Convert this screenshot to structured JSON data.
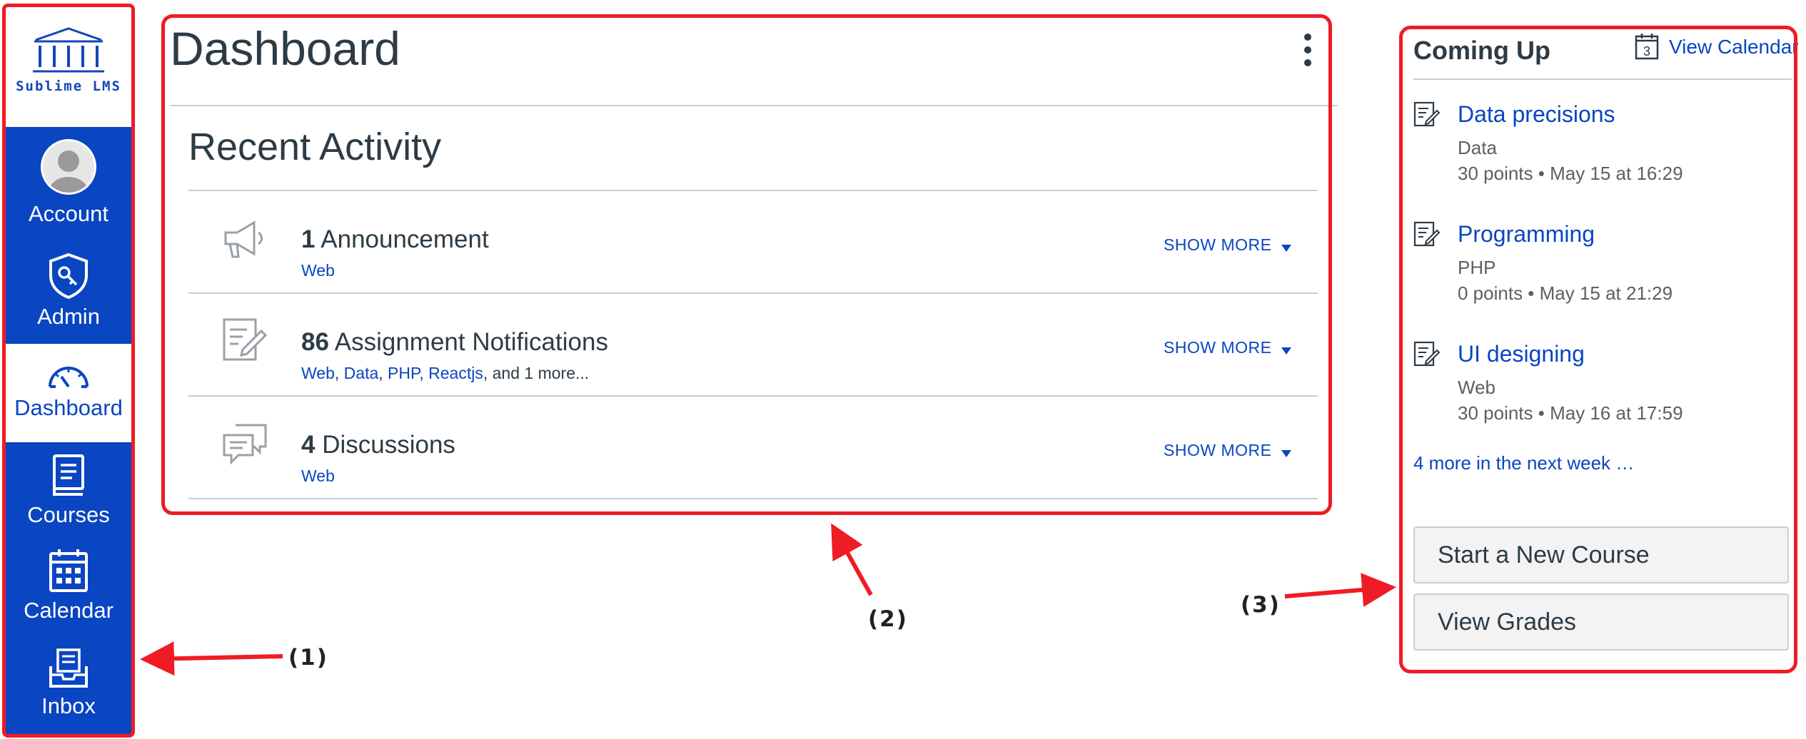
{
  "brand": {
    "name": "Sublime LMS"
  },
  "nav": {
    "items": [
      {
        "label": "Account",
        "icon": "avatar-icon"
      },
      {
        "label": "Admin",
        "icon": "admin-shield-icon"
      },
      {
        "label": "Dashboard",
        "icon": "dashboard-gauge-icon",
        "active": true
      },
      {
        "label": "Courses",
        "icon": "courses-book-icon"
      },
      {
        "label": "Calendar",
        "icon": "calendar-icon"
      },
      {
        "label": "Inbox",
        "icon": "inbox-icon"
      }
    ]
  },
  "dashboard": {
    "title": "Dashboard",
    "recent_activity": {
      "title": "Recent Activity",
      "items": [
        {
          "count": "1",
          "title": "Announcement",
          "icon": "megaphone-icon",
          "links": [
            "Web"
          ],
          "suffix": "",
          "show_more": "SHOW MORE"
        },
        {
          "count": "86",
          "title": "Assignment Notifications",
          "icon": "assignment-icon",
          "links": [
            "Web",
            "Data",
            "PHP",
            "Reactjs"
          ],
          "suffix": ", and 1 more...",
          "show_more": "SHOW MORE"
        },
        {
          "count": "4",
          "title": "Discussions",
          "icon": "discussion-icon",
          "links": [
            "Web"
          ],
          "suffix": "",
          "show_more": "SHOW MORE"
        }
      ]
    }
  },
  "coming_up": {
    "title": "Coming Up",
    "view_calendar": "View Calendar",
    "calendar_day": "3",
    "items": [
      {
        "title": "Data precisions",
        "course": "Data",
        "meta": "30 points • May 15 at 16:29"
      },
      {
        "title": "Programming",
        "course": "PHP",
        "meta": "0 points • May 15 at 21:29"
      },
      {
        "title": "UI designing",
        "course": "Web",
        "meta": "30 points • May 16 at 17:59"
      }
    ],
    "more": "4 more in the next week …"
  },
  "buttons": {
    "start_course": "Start a New Course",
    "view_grades": "View Grades"
  },
  "annotations": {
    "label_1": "(1)",
    "label_2": "(2)",
    "label_3": "(3)"
  },
  "colors": {
    "nav_bg": "#0a45c2",
    "link": "#0a45c2",
    "annotation": "#ef1c25",
    "text": "#2d3b45"
  }
}
